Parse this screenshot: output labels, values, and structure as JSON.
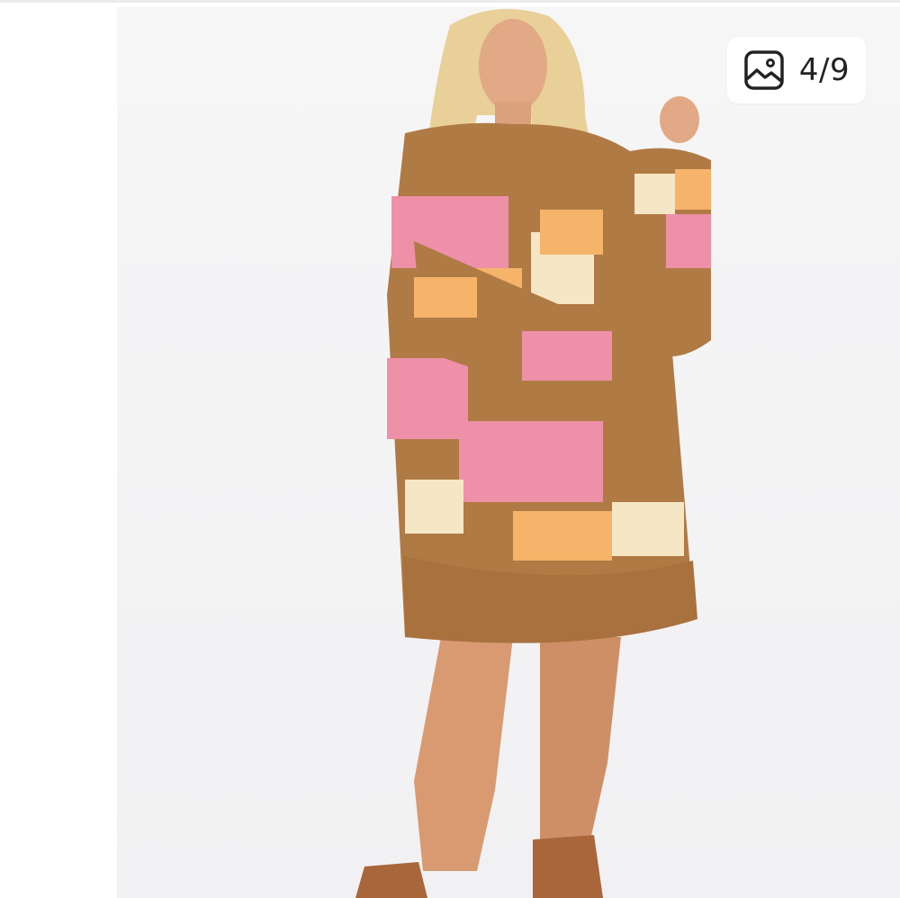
{
  "viewer": {
    "counter": {
      "icon": "image-gallery-icon",
      "text": "4/9"
    },
    "photo": {
      "subject": "product-photo"
    }
  },
  "colors": {
    "background": "#ffffff",
    "photo_bg": "#f3f3f5",
    "badge_bg": "#ffffff",
    "badge_text": "#222222",
    "sweater_brown": "#b07a45",
    "sweater_pink": "#ee90a8",
    "sweater_cream": "#f5e6c5",
    "sweater_orange": "#f5b46a",
    "skin": "#d99a72",
    "hair": "#e9cf98",
    "boots": "#a9663a"
  }
}
